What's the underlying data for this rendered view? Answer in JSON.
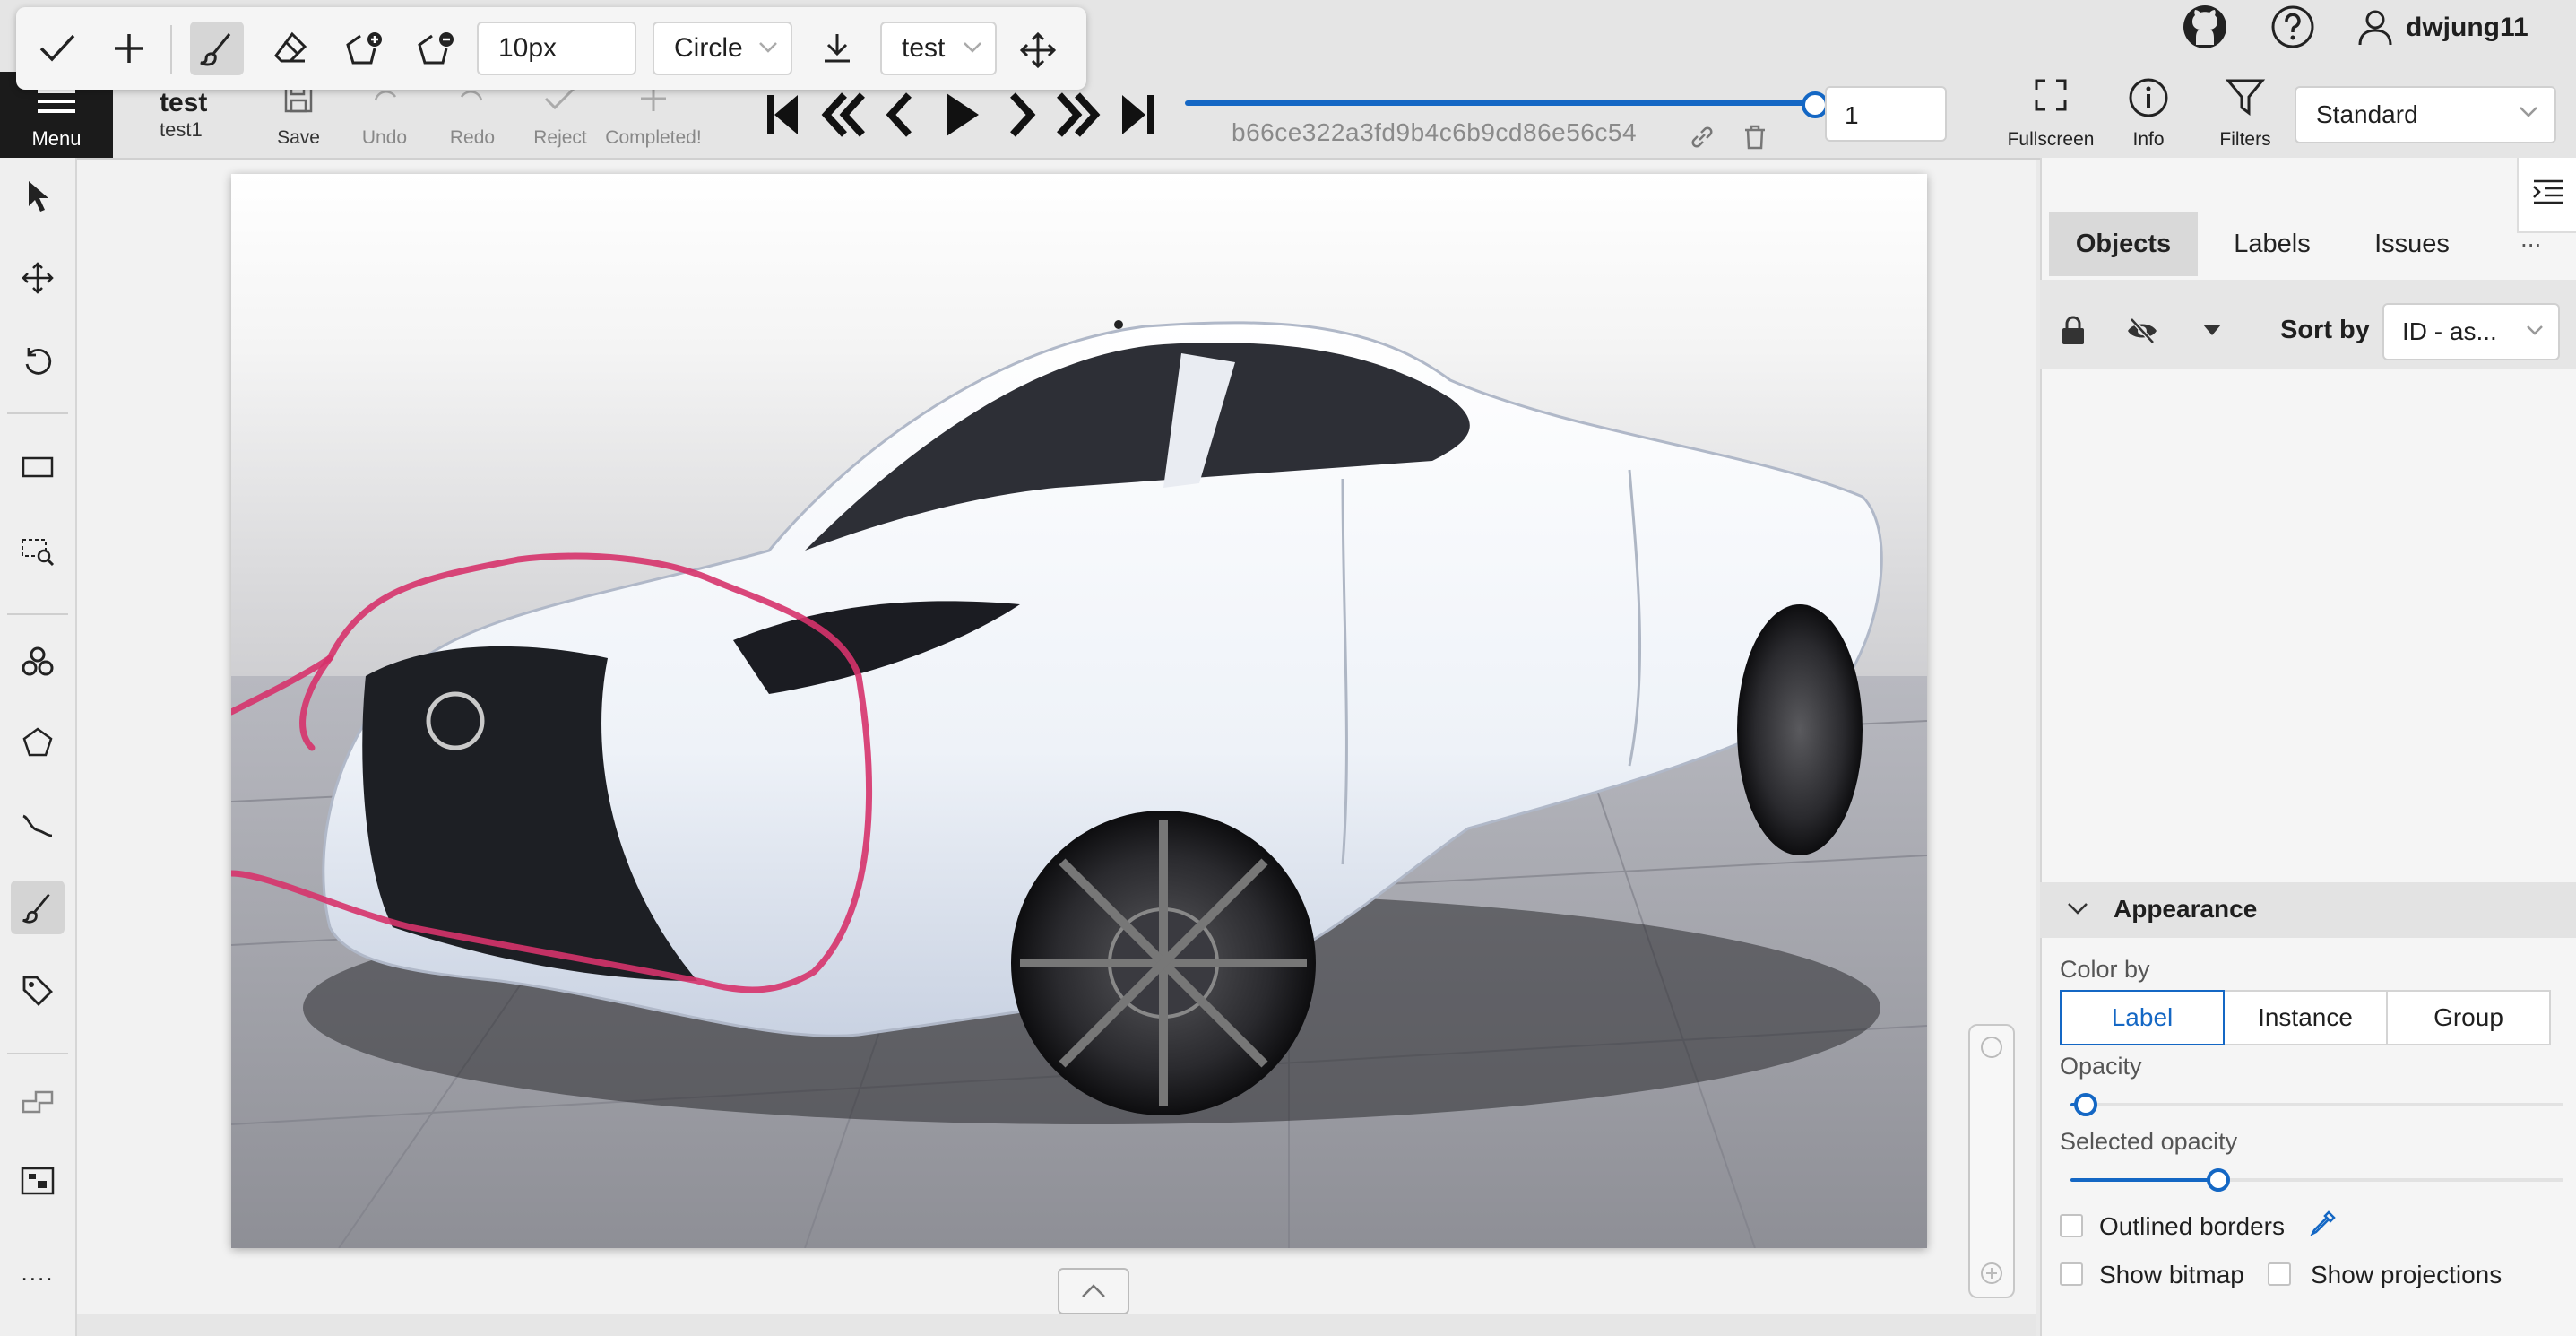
{
  "draw_toolbar": {
    "brush_size": "10px",
    "brush_shape": "Circle",
    "label": "test"
  },
  "header": {
    "menu_label": "Menu",
    "job_title": "test",
    "job_subtitle": "test1",
    "save_label": "Save",
    "undo_label": "Undo",
    "redo_label": "Redo",
    "reject_label": "Reject",
    "completed_label": "Completed!",
    "frame_number": "1",
    "frame_name": "b66ce322a3fd9b4c6b9cd86e56c54",
    "fullscreen_label": "Fullscreen",
    "info_label": "Info",
    "filters_label": "Filters",
    "workspace": "Standard",
    "username": "dwjung11",
    "frame_progress": 1.0
  },
  "right_panel": {
    "tabs": [
      "Objects",
      "Labels",
      "Issues"
    ],
    "active_tab": "Objects",
    "more": "...",
    "sort_by_label": "Sort by",
    "sort_value": "ID - as...",
    "appearance": {
      "title": "Appearance",
      "color_by_label": "Color by",
      "color_by_options": [
        "Label",
        "Instance",
        "Group"
      ],
      "color_by_selected": "Label",
      "opacity_label": "Opacity",
      "opacity_value": 0.03,
      "selected_opacity_label": "Selected opacity",
      "selected_opacity_value": 0.3,
      "outlined_borders_label": "Outlined borders",
      "show_bitmap_label": "Show bitmap",
      "show_projections_label": "Show projections"
    }
  },
  "left_toolbar": {
    "more": "...."
  },
  "colors": {
    "accent": "#1467c4",
    "annotation_stroke": "#d6336c",
    "menu_bg": "#1b1b1b"
  }
}
